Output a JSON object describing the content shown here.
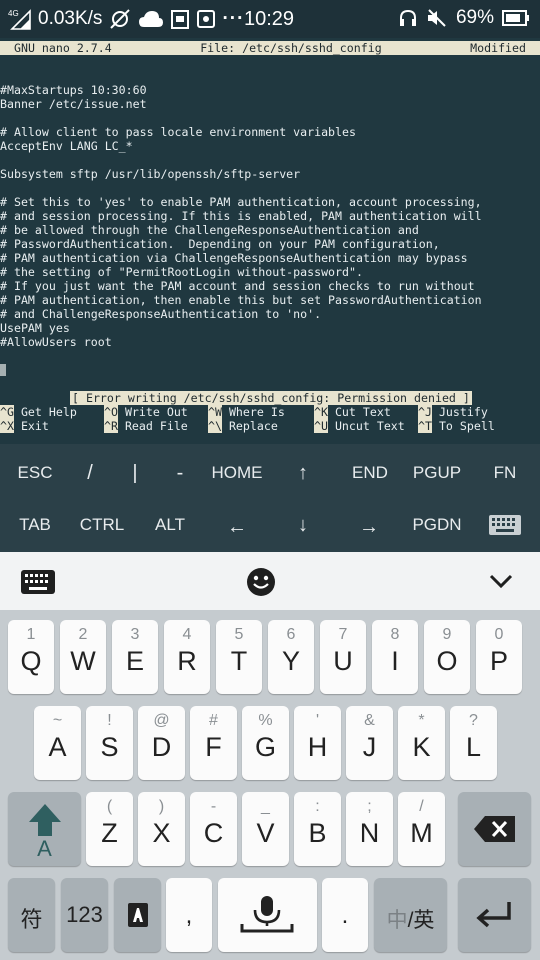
{
  "status_bar": {
    "signal": "4G",
    "speed": "0.03K/s",
    "time": "10:29",
    "battery": "69%",
    "icons": [
      "signal-icon",
      "data-saver-icon",
      "cloud-icon",
      "notification-icon",
      "screenshot-icon",
      "more-dots-icon",
      "headset-icon",
      "mute-icon",
      "battery-icon"
    ],
    "more": "···"
  },
  "nano": {
    "title_left": "GNU nano 2.7.4",
    "title_center": "File: /etc/ssh/sshd_config",
    "title_right": "Modified",
    "lines": [
      "#MaxStartups 10:30:60",
      "Banner /etc/issue.net",
      "",
      "# Allow client to pass locale environment variables",
      "AcceptEnv LANG LC_*",
      "",
      "Subsystem sftp /usr/lib/openssh/sftp-server",
      "",
      "# Set this to 'yes' to enable PAM authentication, account processing,",
      "# and session processing. If this is enabled, PAM authentication will",
      "# be allowed through the ChallengeResponseAuthentication and",
      "# PasswordAuthentication.  Depending on your PAM configuration,",
      "# PAM authentication via ChallengeResponseAuthentication may bypass",
      "# the setting of \"PermitRootLogin without-password\".",
      "# If you just want the PAM account and session checks to run without",
      "# PAM authentication, then enable this but set PasswordAuthentication",
      "# and ChallengeResponseAuthentication to 'no'.",
      "UsePAM yes",
      "#AllowUsers root"
    ],
    "error": "[ Error writing /etc/ssh/sshd_config: Permission denied ]",
    "shortcuts_row1": [
      {
        "key": "^G",
        "label": "Get Help"
      },
      {
        "key": "^O",
        "label": "Write Out"
      },
      {
        "key": "^W",
        "label": "Where Is"
      },
      {
        "key": "^K",
        "label": "Cut Text"
      },
      {
        "key": "^J",
        "label": "Justify"
      }
    ],
    "shortcuts_row2": [
      {
        "key": "^X",
        "label": "Exit"
      },
      {
        "key": "^R",
        "label": "Read File"
      },
      {
        "key": "^\\",
        "label": "Replace"
      },
      {
        "key": "^U",
        "label": "Uncut Text"
      },
      {
        "key": "^T",
        "label": "To Spell"
      }
    ]
  },
  "extra_keys": {
    "row1": [
      "ESC",
      "/",
      "|",
      "-",
      "HOME",
      "↑",
      "END",
      "PGUP",
      "FN"
    ],
    "row2": [
      "TAB",
      "CTRL",
      "ALT",
      "←",
      "↓",
      "→",
      "PGDN"
    ],
    "keyboard_toggle_icon": "keyboard-icon"
  },
  "keyboard_toolbar": {
    "icons": [
      "keyboard-icon",
      "emoji-icon",
      "chevron-down-icon"
    ]
  },
  "keyboard": {
    "row1": [
      {
        "hint": "1",
        "main": "Q"
      },
      {
        "hint": "2",
        "main": "W"
      },
      {
        "hint": "3",
        "main": "E"
      },
      {
        "hint": "4",
        "main": "R"
      },
      {
        "hint": "5",
        "main": "T"
      },
      {
        "hint": "6",
        "main": "Y"
      },
      {
        "hint": "7",
        "main": "U"
      },
      {
        "hint": "8",
        "main": "I"
      },
      {
        "hint": "9",
        "main": "O"
      },
      {
        "hint": "0",
        "main": "P"
      }
    ],
    "row2": [
      {
        "hint": "~",
        "main": "A"
      },
      {
        "hint": "!",
        "main": "S"
      },
      {
        "hint": "@",
        "main": "D"
      },
      {
        "hint": "#",
        "main": "F"
      },
      {
        "hint": "%",
        "main": "G"
      },
      {
        "hint": "'",
        "main": "H"
      },
      {
        "hint": "&",
        "main": "J"
      },
      {
        "hint": "*",
        "main": "K"
      },
      {
        "hint": "?",
        "main": "L"
      }
    ],
    "row3": [
      {
        "hint": "(",
        "main": "Z"
      },
      {
        "hint": ")",
        "main": "X"
      },
      {
        "hint": "-",
        "main": "C"
      },
      {
        "hint": "_",
        "main": "V"
      },
      {
        "hint": ":",
        "main": "B"
      },
      {
        "hint": ";",
        "main": "N"
      },
      {
        "hint": "/",
        "main": "M"
      }
    ],
    "shift_label": "A",
    "bottom": {
      "symbols": "符",
      "numbers": "123",
      "comma": ",",
      "period": ".",
      "lang_cn": "中",
      "lang_sep": "/",
      "lang_en": "英"
    }
  },
  "colors": {
    "terminal_bg": "#203840",
    "highlight": "#e8e4cf",
    "extra_keys_bg": "#2b4048",
    "keyboard_bg": "#c5cbcf",
    "shift_accent": "#2f5f60"
  }
}
